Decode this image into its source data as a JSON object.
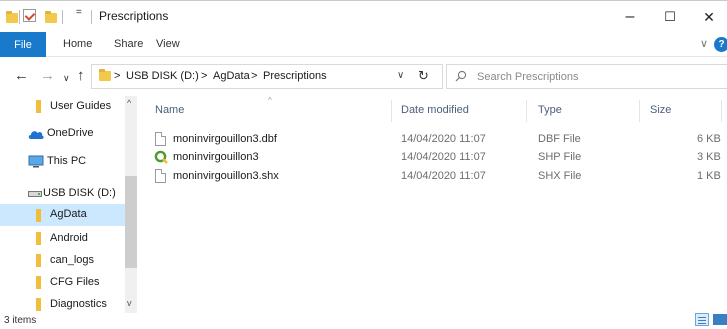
{
  "window": {
    "title": "Prescriptions",
    "qa_dropdown": "=",
    "minimize": "–",
    "maximize": "☐",
    "close": "✕"
  },
  "ribbon": {
    "tabs": [
      "File",
      "Home",
      "Share",
      "View"
    ],
    "chevron": "∨",
    "help": "?"
  },
  "address": {
    "back": "←",
    "forward": "→",
    "recent": "∨",
    "up": "↑",
    "crumbs": [
      ">",
      "USB DISK (D:)",
      ">",
      "AgData",
      ">",
      "Prescriptions"
    ],
    "dropdown": "∨",
    "refresh": "↻",
    "search_placeholder": "Search Prescriptions"
  },
  "nav": {
    "items": [
      {
        "label": "User Guides",
        "icon": "folder-icon"
      },
      {
        "label": "OneDrive",
        "icon": "onedrive-icon"
      },
      {
        "label": "This PC",
        "icon": "pc-icon"
      },
      {
        "label": "USB DISK (D:)",
        "icon": "usb-drive-icon"
      },
      {
        "label": "AgData",
        "icon": "folder-icon",
        "selected": true
      },
      {
        "label": "Android",
        "icon": "folder-icon"
      },
      {
        "label": "can_logs",
        "icon": "folder-icon"
      },
      {
        "label": "CFG Files",
        "icon": "folder-icon"
      },
      {
        "label": "Diagnostics",
        "icon": "folder-icon"
      }
    ],
    "scroll_up": "^",
    "scroll_down": "v"
  },
  "columns": {
    "name": "Name",
    "date": "Date modified",
    "type": "Type",
    "size": "Size",
    "sort_indicator": "^"
  },
  "files": [
    {
      "name": "moninvirgouillon3.dbf",
      "date": "14/04/2020 11:07",
      "type": "DBF File",
      "size": "6 KB",
      "icon": "file-icon"
    },
    {
      "name": "moninvirgouillon3",
      "date": "14/04/2020 11:07",
      "type": "SHP File",
      "size": "3 KB",
      "icon": "qgis-icon"
    },
    {
      "name": "moninvirgouillon3.shx",
      "date": "14/04/2020 11:07",
      "type": "SHX File",
      "size": "1 KB",
      "icon": "file-icon"
    }
  ],
  "status": {
    "item_count": "3 items"
  },
  "colors": {
    "accent": "#1979ca",
    "selection": "#cce8ff",
    "folder": "#f0bd3c"
  }
}
